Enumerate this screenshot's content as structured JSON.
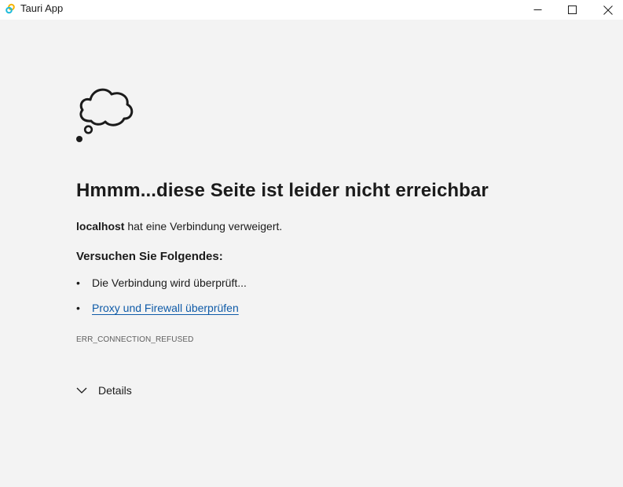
{
  "window": {
    "title": "Tauri App",
    "icons": {
      "app": "tauri-logo-icon",
      "minimize": "minimize-icon",
      "maximize": "maximize-icon",
      "close": "close-icon"
    }
  },
  "error_page": {
    "illustration_icon": "thought-cloud-icon",
    "heading": "Hmmm...diese Seite ist leider nicht erreichbar",
    "host": "localhost",
    "description_rest": " hat eine Verbindung verweigert.",
    "try_heading": "Versuchen Sie Folgendes:",
    "suggestions": [
      {
        "bullet": "•",
        "text": "Die Verbindung wird überprüft..."
      },
      {
        "bullet": "•",
        "text": "Proxy und Firewall überprüfen",
        "is_link": true
      }
    ],
    "error_code": "ERR_CONNECTION_REFUSED",
    "details_label": "Details",
    "details_icon": "chevron-down-icon"
  },
  "colors": {
    "background": "#f3f3f3",
    "titlebar": "#ffffff",
    "text": "#1b1b1b",
    "link": "#0f5ba8",
    "muted": "#5f5f5f"
  }
}
